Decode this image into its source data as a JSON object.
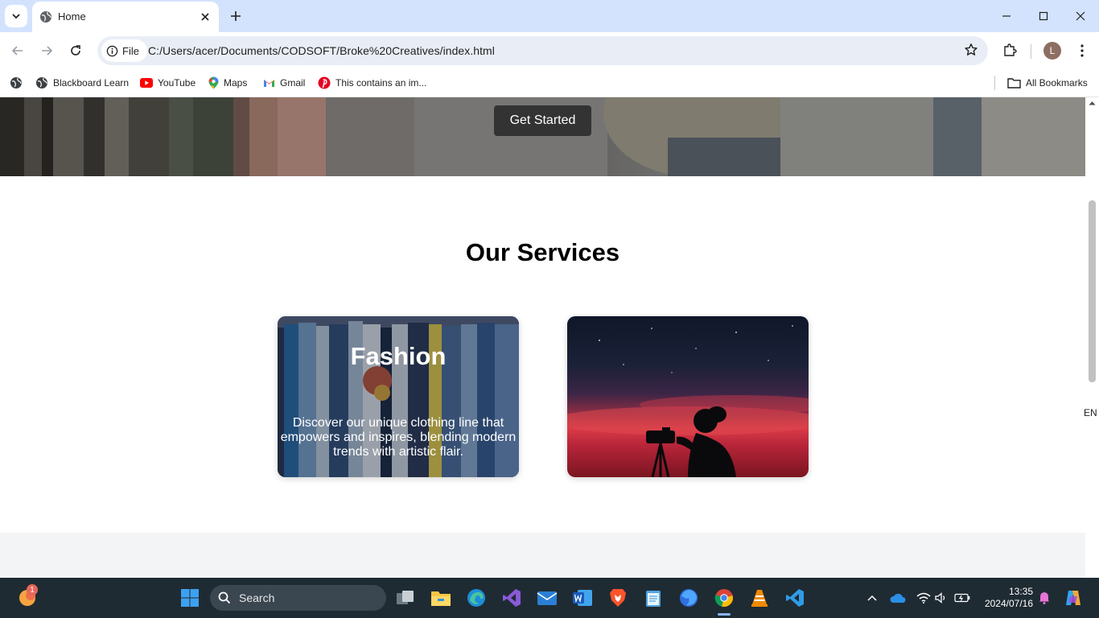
{
  "browser": {
    "tab": {
      "title": "Home"
    },
    "address": {
      "chip_label": "File",
      "url": "C:/Users/acer/Documents/CODSOFT/Broke%20Creatives/index.html"
    },
    "profile_initial": "L",
    "bookmarks": [
      {
        "label": "Blackboard Learn",
        "icon": "globe-icon"
      },
      {
        "label": "YouTube",
        "icon": "youtube-icon"
      },
      {
        "label": "Maps",
        "icon": "maps-icon"
      },
      {
        "label": "Gmail",
        "icon": "gmail-icon"
      },
      {
        "label": "This contains an im...",
        "icon": "pinterest-icon"
      }
    ],
    "all_bookmarks_label": "All Bookmarks"
  },
  "page": {
    "hero": {
      "cta_label": "Get Started"
    },
    "services": {
      "title": "Our Services",
      "cards": [
        {
          "title": "Fashion",
          "description": "Discover our unique clothing line that empowers and inspires, blending modern trends with artistic flair."
        },
        {
          "image": "photographer-silhouette-sunset"
        }
      ]
    }
  },
  "side": {
    "language": "EN"
  },
  "taskbar": {
    "search_label": "Search",
    "notification_count": "1",
    "time": "13:35",
    "date": "2024/07/16"
  },
  "colors": {
    "tab_strip": "#d3e3fd",
    "omnibox": "#e9eef6",
    "button_dark": "#333333",
    "taskbar": "#1f2b33",
    "footer": "#f3f4f6"
  }
}
